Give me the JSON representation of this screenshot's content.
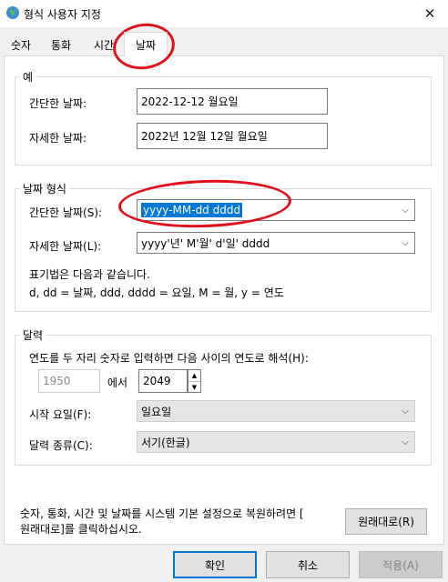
{
  "window": {
    "title": "형식 사용자 지정",
    "close_glyph": "✕"
  },
  "tabs": [
    {
      "label": "숫자"
    },
    {
      "label": "통화"
    },
    {
      "label": "시간"
    },
    {
      "label": "날짜"
    }
  ],
  "example": {
    "group_label": "예",
    "short_label": "간단한 날짜:",
    "short_value": "2022-12-12 월요일",
    "long_label": "자세한 날짜:",
    "long_value": "2022년 12월 12일 월요일"
  },
  "date_format": {
    "group_label": "날짜 형식",
    "short_label": "간단한 날짜(S):",
    "short_value": "yyyy-MM-dd dddd",
    "long_label": "자세한 날짜(L):",
    "long_value": "yyyy'년' M'월' d'일' dddd",
    "notation_line1": "표기법은 다음과 같습니다.",
    "notation_line2": "d, dd = 날짜,  ddd, dddd = 요일,  M = 월,  y = 연도"
  },
  "calendar": {
    "group_label": "달력",
    "two_digit_label": "연도를 두 자리 숫자로 입력하면 다음 사이의 연도로 해석(H):",
    "year_from": "1950",
    "between_label": "에서",
    "year_to": "2049",
    "first_day_label": "시작 요일(F):",
    "first_day_value": "일요일",
    "calendar_type_label": "달력 종류(C):",
    "calendar_type_value": "서기(한글)"
  },
  "reset": {
    "text_line1": "숫자, 통화, 시간 및 날짜를 시스템 기본 설정으로 복원하려면 [",
    "text_line2": "원래대로]를 클릭하십시오.",
    "button": "원래대로(R)"
  },
  "footer": {
    "ok": "확인",
    "cancel": "취소",
    "apply": "적용(A)"
  },
  "colors": {
    "selection": "#0078d7",
    "annotation": "#e0101a"
  }
}
